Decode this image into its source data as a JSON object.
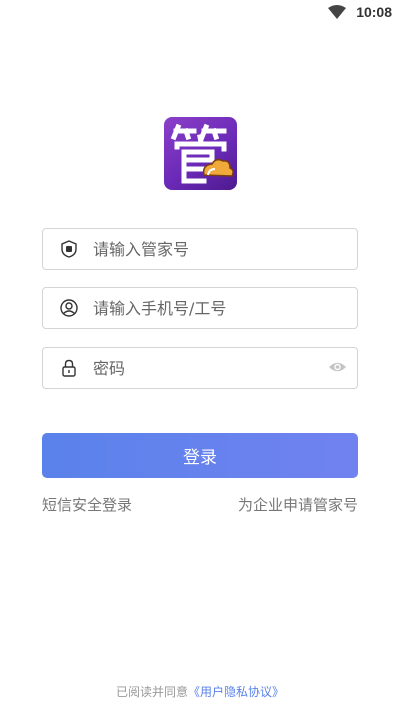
{
  "status_bar": {
    "time": "10:08",
    "wifi_icon": "wifi-icon"
  },
  "app": {
    "logo_icon": "app-logo-guan"
  },
  "form": {
    "butler_id": {
      "placeholder": "请输入管家号",
      "icon": "shield-guan-icon"
    },
    "phone": {
      "placeholder": "请输入手机号/工号",
      "icon": "user-icon"
    },
    "password": {
      "placeholder": "密码",
      "icon": "lock-icon",
      "toggle_icon": "eye-icon"
    }
  },
  "actions": {
    "login_label": "登录",
    "sms_login_label": "短信安全登录",
    "apply_label": "为企业申请管家号"
  },
  "agreement": {
    "prefix": "已阅读并同意",
    "link": "《用户隐私协议》"
  },
  "colors": {
    "accent": "#5a82ea",
    "logo_purple": "#6b2ab8",
    "border": "#d5d5d5"
  }
}
